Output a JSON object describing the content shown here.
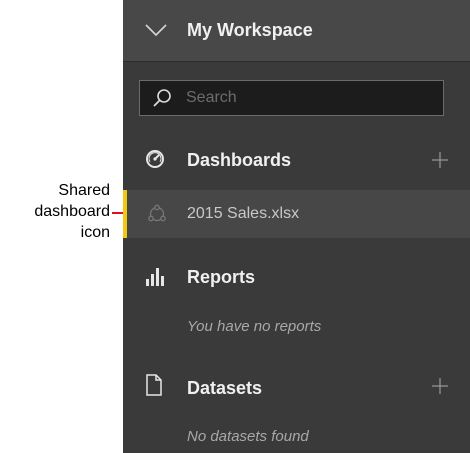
{
  "annotation": {
    "lines": [
      "Shared",
      "dashboard",
      "icon"
    ]
  },
  "workspace": {
    "title": "My Workspace",
    "expand_icon": "chevron-down-icon"
  },
  "search": {
    "placeholder": "Search",
    "value": "",
    "icon": "search-icon"
  },
  "sections": {
    "dashboards": {
      "label": "Dashboards",
      "icon": "gauge-icon",
      "add_icon": "plus-icon",
      "items": [
        {
          "label": "2015 Sales.xlsx",
          "icon": "shared-dashboard-icon",
          "selected": true
        }
      ]
    },
    "reports": {
      "label": "Reports",
      "icon": "bar-chart-icon",
      "empty_text": "You have no reports"
    },
    "datasets": {
      "label": "Datasets",
      "icon": "document-icon",
      "add_icon": "plus-icon",
      "empty_text": "No datasets found"
    }
  },
  "colors": {
    "panel_bg": "#3a3a3a",
    "header_bg": "#484848",
    "selected_item_bg": "#474747",
    "accent_yellow": "#f2c811",
    "callout_red": "#d9131b"
  }
}
